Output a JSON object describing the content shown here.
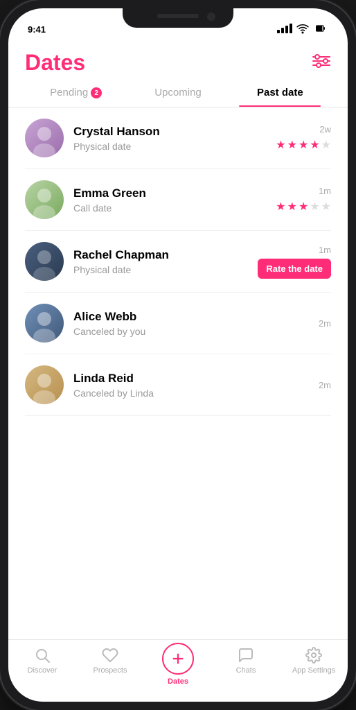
{
  "app": {
    "title": "Dates",
    "filter_icon": "⚙",
    "status_time": "9:41"
  },
  "tabs": [
    {
      "id": "pending",
      "label": "Pending",
      "badge": "2",
      "active": false
    },
    {
      "id": "upcoming",
      "label": "Upcoming",
      "badge": null,
      "active": false
    },
    {
      "id": "past_date",
      "label": "Past date",
      "badge": null,
      "active": true
    }
  ],
  "dates": [
    {
      "id": 1,
      "name": "Crystal Hanson",
      "type": "Physical date",
      "time": "2w",
      "rating": 4,
      "max_rating": 5,
      "status": "rated",
      "avatar_class": "avatar-1"
    },
    {
      "id": 2,
      "name": "Emma Green",
      "type": "Call date",
      "time": "1m",
      "rating": 3,
      "max_rating": 5,
      "status": "rated",
      "avatar_class": "avatar-2"
    },
    {
      "id": 3,
      "name": "Rachel Chapman",
      "type": "Physical date",
      "time": "1m",
      "rating": null,
      "max_rating": 5,
      "status": "rate",
      "rate_label": "Rate the date",
      "avatar_class": "avatar-3"
    },
    {
      "id": 4,
      "name": "Alice Webb",
      "type": "Canceled by you",
      "time": "2m",
      "rating": null,
      "status": "canceled",
      "avatar_class": "avatar-4"
    },
    {
      "id": 5,
      "name": "Linda Reid",
      "type": "Canceled by Linda",
      "time": "2m",
      "rating": null,
      "status": "canceled",
      "avatar_class": "avatar-5"
    }
  ],
  "nav": [
    {
      "id": "discover",
      "label": "Discover",
      "icon": "search",
      "active": false
    },
    {
      "id": "prospects",
      "label": "Prospects",
      "icon": "heart",
      "active": false
    },
    {
      "id": "dates",
      "label": "Dates",
      "icon": "plus",
      "active": true
    },
    {
      "id": "chats",
      "label": "Chats",
      "icon": "chat",
      "active": false
    },
    {
      "id": "settings",
      "label": "App Settings",
      "icon": "gear",
      "active": false
    }
  ]
}
